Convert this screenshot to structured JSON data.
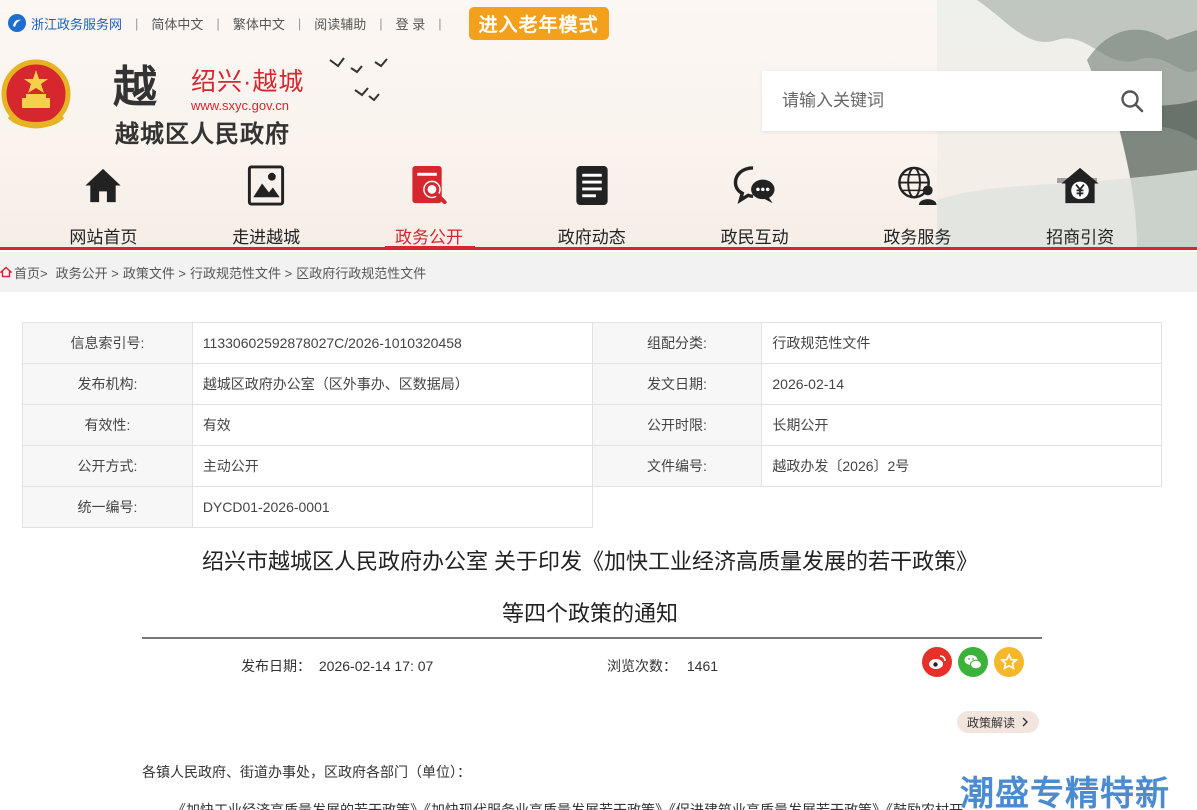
{
  "topbar": {
    "portal": "浙江政务服务网",
    "simplified": "简体中文",
    "traditional": "繁体中文",
    "reading_aid": "阅读辅助",
    "login": "登 录",
    "elder_mode": "进入老年模式"
  },
  "logo": {
    "mark": "越",
    "city": "绍兴·越城",
    "url": "www.sxyc.gov.cn",
    "gov_name": "越城区人民政府"
  },
  "search": {
    "placeholder": "请输入关键词"
  },
  "nav": [
    {
      "label": "网站首页",
      "icon": "home-icon"
    },
    {
      "label": "走进越城",
      "icon": "picture-icon"
    },
    {
      "label": "政务公开",
      "icon": "doc-search-icon"
    },
    {
      "label": "政府动态",
      "icon": "news-icon"
    },
    {
      "label": "政民互动",
      "icon": "chat-icon"
    },
    {
      "label": "政务服务",
      "icon": "globe-user-icon"
    },
    {
      "label": "招商引资",
      "icon": "yuan-house-icon"
    }
  ],
  "breadcrumb": [
    "首页>",
    "政务公开 >",
    "政策文件 >",
    "行政规范性文件 >",
    "区政府行政规范性文件"
  ],
  "info": {
    "index_no_label": "信息索引号:",
    "index_no": "11330602592878027C/2026-1010320458",
    "category_label": "组配分类:",
    "category": "行政规范性文件",
    "issuer_label": "发布机构:",
    "issuer": "越城区政府办公室（区外事办、区数据局）",
    "issue_date_label": "发文日期:",
    "issue_date": "2026-02-14",
    "validity_label": "有效性:",
    "validity": "有效",
    "open_period_label": "公开时限:",
    "open_period": "长期公开",
    "open_mode_label": "公开方式:",
    "open_mode": "主动公开",
    "doc_no_label": "文件编号:",
    "doc_no": "越政办发〔2026〕2号",
    "unified_no_label": "统一编号:",
    "unified_no": "DYCD01-2026-0001"
  },
  "article": {
    "title_line1": "绍兴市越城区人民政府办公室 关于印发《加快工业经济高质量发展的若干政策》",
    "title_line2": "等四个政策的通知",
    "publish_label": "发布日期：",
    "publish_time": "2026-02-14 17: 07",
    "views_label": "浏览次数：",
    "views": "1461",
    "interpret_label": "政策解读",
    "salutation": "各镇人民政府、街道办事处，区政府各部门（单位）：",
    "first_line": "《加快工业经济高质量发展的若干政策》《加快现代服务业高质量发展若干政策》《促进建筑业高质量发展若干政策》《鼓励农村开"
  },
  "watermark": "潮盛专精特新",
  "colors": {
    "accent_red": "#d6262e",
    "elder_orange": "#f3a11d",
    "portal_blue": "#1c5fb8"
  }
}
